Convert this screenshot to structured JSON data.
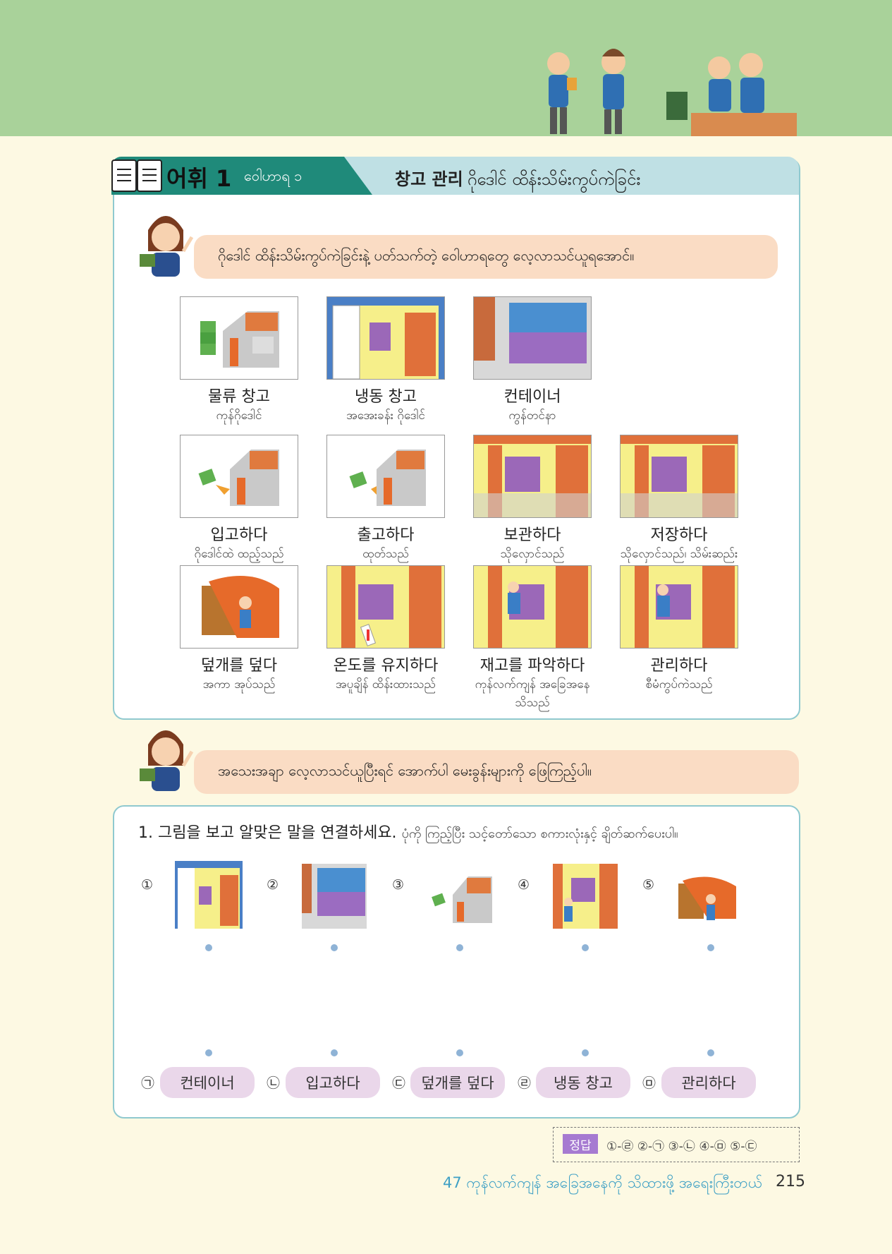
{
  "header": {
    "vocab_label": "어휘 1",
    "vocab_sub": "ဝေါဟာရ ၁",
    "title_ko": "창고 관리",
    "title_my": "ဂိုဒေါင် ထိန်းသိမ်းကွပ်ကဲခြင်း"
  },
  "intro": {
    "speech": "ဂိုဒေါင် ထိန်းသိမ်းကွပ်ကဲခြင်းနဲ့ ပတ်သက်တဲ့ ဝေါဟာရတွေ လေ့လာသင်ယူရအောင်။"
  },
  "vocab": [
    {
      "ko": "물류 창고",
      "my": "ကုန်ဂိုဒေါင်"
    },
    {
      "ko": "냉동 창고",
      "my": "အအေးခန်း ဂိုဒေါင်"
    },
    {
      "ko": "컨테이너",
      "my": "ကွန်တင်နာ"
    },
    {
      "ko": "입고하다",
      "my": "ဂိုဒေါင်ထဲ ထည့်သည်"
    },
    {
      "ko": "출고하다",
      "my": "ထုတ်သည်"
    },
    {
      "ko": "보관하다",
      "my": "သိုလှောင်သည်"
    },
    {
      "ko": "저장하다",
      "my": "သိုလှောင်သည်၊ သိမ်းဆည်းသည်"
    },
    {
      "ko": "덮개를 덮다",
      "my": "အကာ အုပ်သည်"
    },
    {
      "ko": "온도를 유지하다",
      "my": "အပူချိန် ထိန်းထားသည်"
    },
    {
      "ko": "재고를 파악하다",
      "my": "ကုန်လက်ကျန် အခြေအနေ သိသည်"
    },
    {
      "ko": "관리하다",
      "my": "စီမံကွပ်ကဲသည်"
    }
  ],
  "practice_intro": {
    "speech": "အသေးအချာ လေ့လာသင်ယူပြီးရင် အောက်ပါ မေးခွန်းများကို  ဖြေကြည့်ပါ။"
  },
  "question": {
    "title_ko": "1. 그림을 보고 알맞은 말을 연결하세요.",
    "title_my": "ပုံကို ကြည့်ပြီး သင့်တော်သော စကားလုံးနှင့် ချိတ်ဆက်ပေးပါ။",
    "numbers": [
      "①",
      "②",
      "③",
      "④",
      "⑤"
    ],
    "letters": [
      "㉠",
      "㉡",
      "㉢",
      "㉣",
      "㉤"
    ],
    "options": [
      "컨테이너",
      "입고하다",
      "덮개를 덮다",
      "냉동 창고",
      "관리하다"
    ]
  },
  "answer": {
    "badge": "정답",
    "text": "①-㉣  ②-㉠  ③-㉡  ④-㉤  ⑤-㉢"
  },
  "footer": {
    "chapter": "47 ကုန်လက်ကျန် အခြေအနေကို သိထားဖို့ အရေးကြီးတယ်",
    "page": "215"
  },
  "colors": {
    "top_band": "#a9d29a",
    "header_dark": "#1f8a7a",
    "header_light": "#bfe0e4",
    "speech_bg": "#fadcc4",
    "pill_bg": "#ead7ea",
    "footer_text": "#3ea0c5"
  }
}
